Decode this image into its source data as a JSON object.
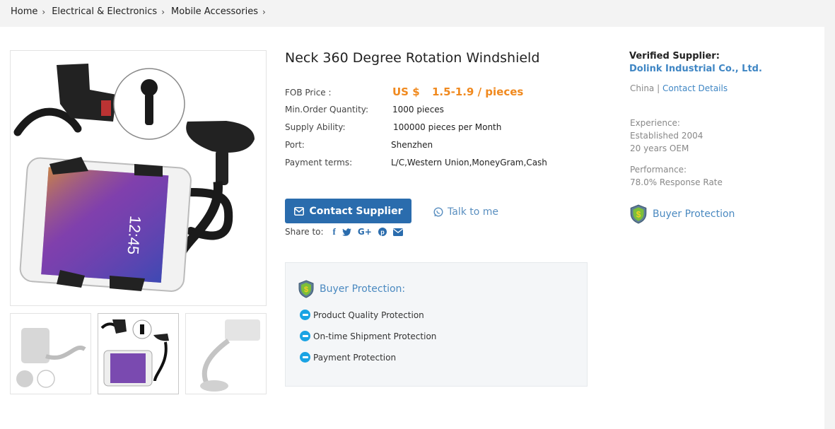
{
  "breadcrumb": {
    "items": [
      "Home",
      "Electrical & Electronics",
      "Mobile Accessories"
    ]
  },
  "product": {
    "title": "Neck 360 Degree Rotation Windshield",
    "fob_label": "FOB Price :",
    "price_currency": "US $",
    "price_value": "1.5-1.9 / pieces",
    "moq_label": "Min.Order Quantity:",
    "moq_value": "1000 pieces",
    "supply_label": "Supply Ability:",
    "supply_value": "100000 pieces per Month",
    "port_label": "Port:",
    "port_value": "Shenzhen",
    "payment_label": "Payment terms:",
    "payment_value": "L/C,Western Union,MoneyGram,Cash"
  },
  "actions": {
    "contact_label": "Contact Supplier",
    "talk_label": "Talk to me",
    "share_label": "Share to:"
  },
  "protection_box": {
    "title": "Buyer Protection:",
    "items": [
      "Product Quality Protection",
      "On-time Shipment Protection",
      "Payment Protection"
    ]
  },
  "supplier": {
    "verified_label": "Verified Supplier:",
    "name": "Dolink Industrial Co., Ltd.",
    "country": "China",
    "divider": "|",
    "contact_link": "Contact Details",
    "experience_label": "Experience:",
    "established": "Established 2004",
    "oem": "20 years OEM",
    "performance_label": "Performance:",
    "response_rate": "78.0% Response Rate",
    "buyer_protection": "Buyer Protection"
  },
  "colors": {
    "accent_blue": "#2a6cad",
    "link_blue": "#3f86c4",
    "price_orange": "#f0891e",
    "badge_cyan": "#1aa3e3"
  }
}
